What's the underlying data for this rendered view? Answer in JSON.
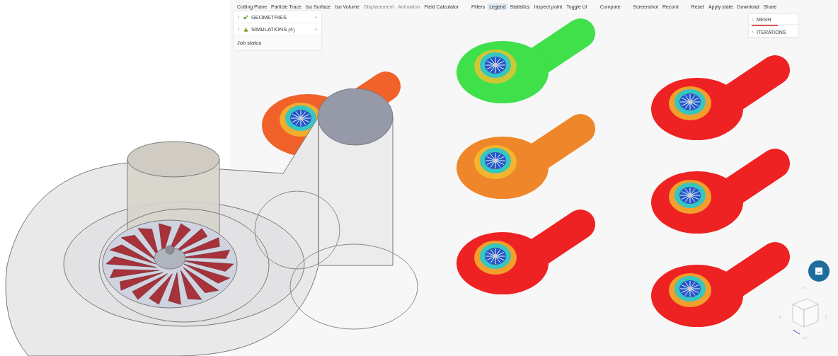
{
  "toolbar": {
    "groups": [
      {
        "tools": [
          {
            "label": "Cutting Plane",
            "disabled": false,
            "selected": false
          },
          {
            "label": "Particle Trace",
            "disabled": false,
            "selected": false
          },
          {
            "label": "Iso Surface",
            "disabled": false,
            "selected": false
          },
          {
            "label": "Iso Volume",
            "disabled": false,
            "selected": false
          },
          {
            "label": "Displacement",
            "disabled": true,
            "selected": false
          },
          {
            "label": "Animation",
            "disabled": true,
            "selected": false
          },
          {
            "label": "Field Calculator",
            "disabled": false,
            "selected": false
          }
        ]
      },
      {
        "tools": [
          {
            "label": "Filters",
            "disabled": false,
            "selected": false
          },
          {
            "label": "Legend",
            "disabled": false,
            "selected": true
          },
          {
            "label": "Statistics",
            "disabled": false,
            "selected": false
          },
          {
            "label": "Inspect point",
            "disabled": false,
            "selected": false
          },
          {
            "label": "Toggle UI",
            "disabled": false,
            "selected": false
          }
        ]
      },
      {
        "tools": [
          {
            "label": "Compare",
            "disabled": false,
            "selected": false
          }
        ]
      },
      {
        "tools": [
          {
            "label": "Screenshot",
            "disabled": false,
            "selected": false
          },
          {
            "label": "Record",
            "disabled": false,
            "selected": false
          }
        ]
      },
      {
        "tools": [
          {
            "label": "Reset",
            "disabled": false,
            "selected": false
          },
          {
            "label": "Apply state",
            "disabled": false,
            "selected": false
          },
          {
            "label": "Download",
            "disabled": false,
            "selected": false
          },
          {
            "label": "Share",
            "disabled": false,
            "selected": false
          }
        ]
      }
    ]
  },
  "tree": {
    "items": [
      {
        "label": "GEOMETRIES",
        "kind": "geometry"
      },
      {
        "label": "SIMULATIONS (4)",
        "kind": "simulation"
      }
    ],
    "job_status": "Job status"
  },
  "side_panel": {
    "items": [
      {
        "label": "MESH",
        "progress": {
          "level": 0.6
        }
      },
      {
        "label": "ITERATIONS"
      }
    ]
  },
  "result_columns": [
    {
      "results": [
        {
          "color": "#f0622a"
        }
      ]
    },
    {
      "results": [
        {
          "color": "#3fe04a"
        },
        {
          "color": "#f0862a"
        },
        {
          "color": "#ee2222"
        }
      ]
    },
    {
      "results": [
        {
          "color": "#ee2222"
        },
        {
          "color": "#ee2222"
        },
        {
          "color": "#ee2222"
        }
      ]
    }
  ]
}
